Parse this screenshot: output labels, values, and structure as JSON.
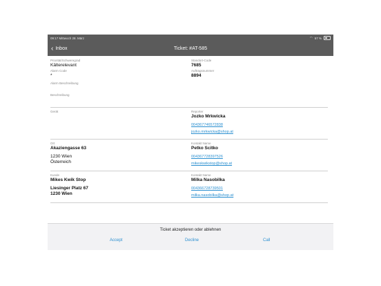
{
  "statusbar": {
    "time_date": "09:17   Mittwoch 28. März",
    "battery": "57 %"
  },
  "nav": {
    "back_label": "Inbox",
    "title": "Ticket: #AT-585"
  },
  "fields": {
    "priority": {
      "label": "Priorität/Schweregrad",
      "value": "Kälterelevant"
    },
    "site_code": {
      "label": "Standort-Code",
      "value": "7685"
    },
    "alarm_code": {
      "label": "Alarm Code",
      "value": "*"
    },
    "order_number": {
      "label": "Auftragsnummer",
      "value": "8894"
    },
    "alarm_description": {
      "label": "Alarm Beschreibung"
    },
    "description": {
      "label": "Beschreibung"
    },
    "device": {
      "label": "Gerät"
    },
    "reporter": {
      "label": "Reporter",
      "name": "Jozko Mrkwicka",
      "phone": "004367746572838",
      "email": "jozko.mrkwicka@shop.at"
    },
    "location": {
      "label": "Ort",
      "street": "Akaziengasse 63",
      "city": "1230 Wien",
      "country": "Österreich"
    },
    "contact1": {
      "label": "Kontakt Name",
      "name": "Petko Scitko",
      "phone": "004367728397526",
      "email": "mikeskwikstop@shop.at"
    },
    "customer": {
      "label": "Kunde",
      "name": "Mikes Kwik Stop",
      "street": "Liesinger Platz 67",
      "city": "1230 Wien"
    },
    "contact2": {
      "label": "Kontakt Name",
      "name": "Milka Nasobilka",
      "phone": "004366728739501",
      "email": "milka.nasobilka@shop.at"
    }
  },
  "action_sheet": {
    "title": "Ticket akzeptieren oder ablehnen",
    "accept": "Accept",
    "decline": "Decline",
    "call": "Call"
  },
  "colors": {
    "bar": "#5b5b5b",
    "link": "#2a8fd0"
  }
}
